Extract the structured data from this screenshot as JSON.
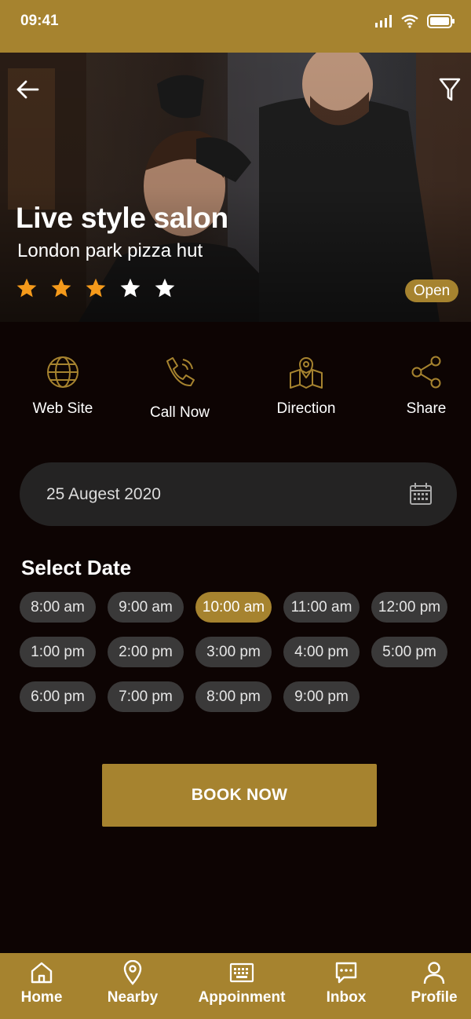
{
  "status_bar": {
    "time": "09:41"
  },
  "hero": {
    "title": "Live style salon",
    "address": "London park  pizza hut",
    "rating": {
      "value": 3,
      "max": 5
    },
    "status_badge": "Open"
  },
  "actions": [
    {
      "label": "Web Site",
      "icon": "globe-icon"
    },
    {
      "label": "Call Now",
      "icon": "phone-icon"
    },
    {
      "label": "Direction",
      "icon": "map-pin-icon"
    },
    {
      "label": "Share",
      "icon": "share-icon"
    }
  ],
  "date_field": {
    "value": "25 Augest 2020",
    "icon": "calendar-icon"
  },
  "select_date": {
    "title": "Select Date",
    "slots": [
      "8:00 am",
      "9:00 am",
      "10:00 am",
      "11:00 am",
      "12:00 pm",
      "1:00 pm",
      "2:00 pm",
      "3:00 pm",
      "4:00 pm",
      "5:00 pm",
      "6:00 pm",
      "7:00 pm",
      "8:00 pm",
      "9:00 pm"
    ],
    "selected": "10:00 am"
  },
  "book_button": {
    "label": "BOOK NOW"
  },
  "bottom_nav": [
    {
      "label": "Home",
      "icon": "home-icon"
    },
    {
      "label": "Nearby",
      "icon": "location-icon"
    },
    {
      "label": "Appoinment",
      "icon": "keyboard-icon"
    },
    {
      "label": "Inbox",
      "icon": "message-icon"
    },
    {
      "label": "Profile",
      "icon": "user-icon"
    }
  ],
  "colors": {
    "accent": "#a6832f",
    "background": "#0d0403",
    "field": "#242323",
    "chip": "#3a3939",
    "star_filled": "#f59a1b",
    "star_empty": "#ffffff"
  }
}
